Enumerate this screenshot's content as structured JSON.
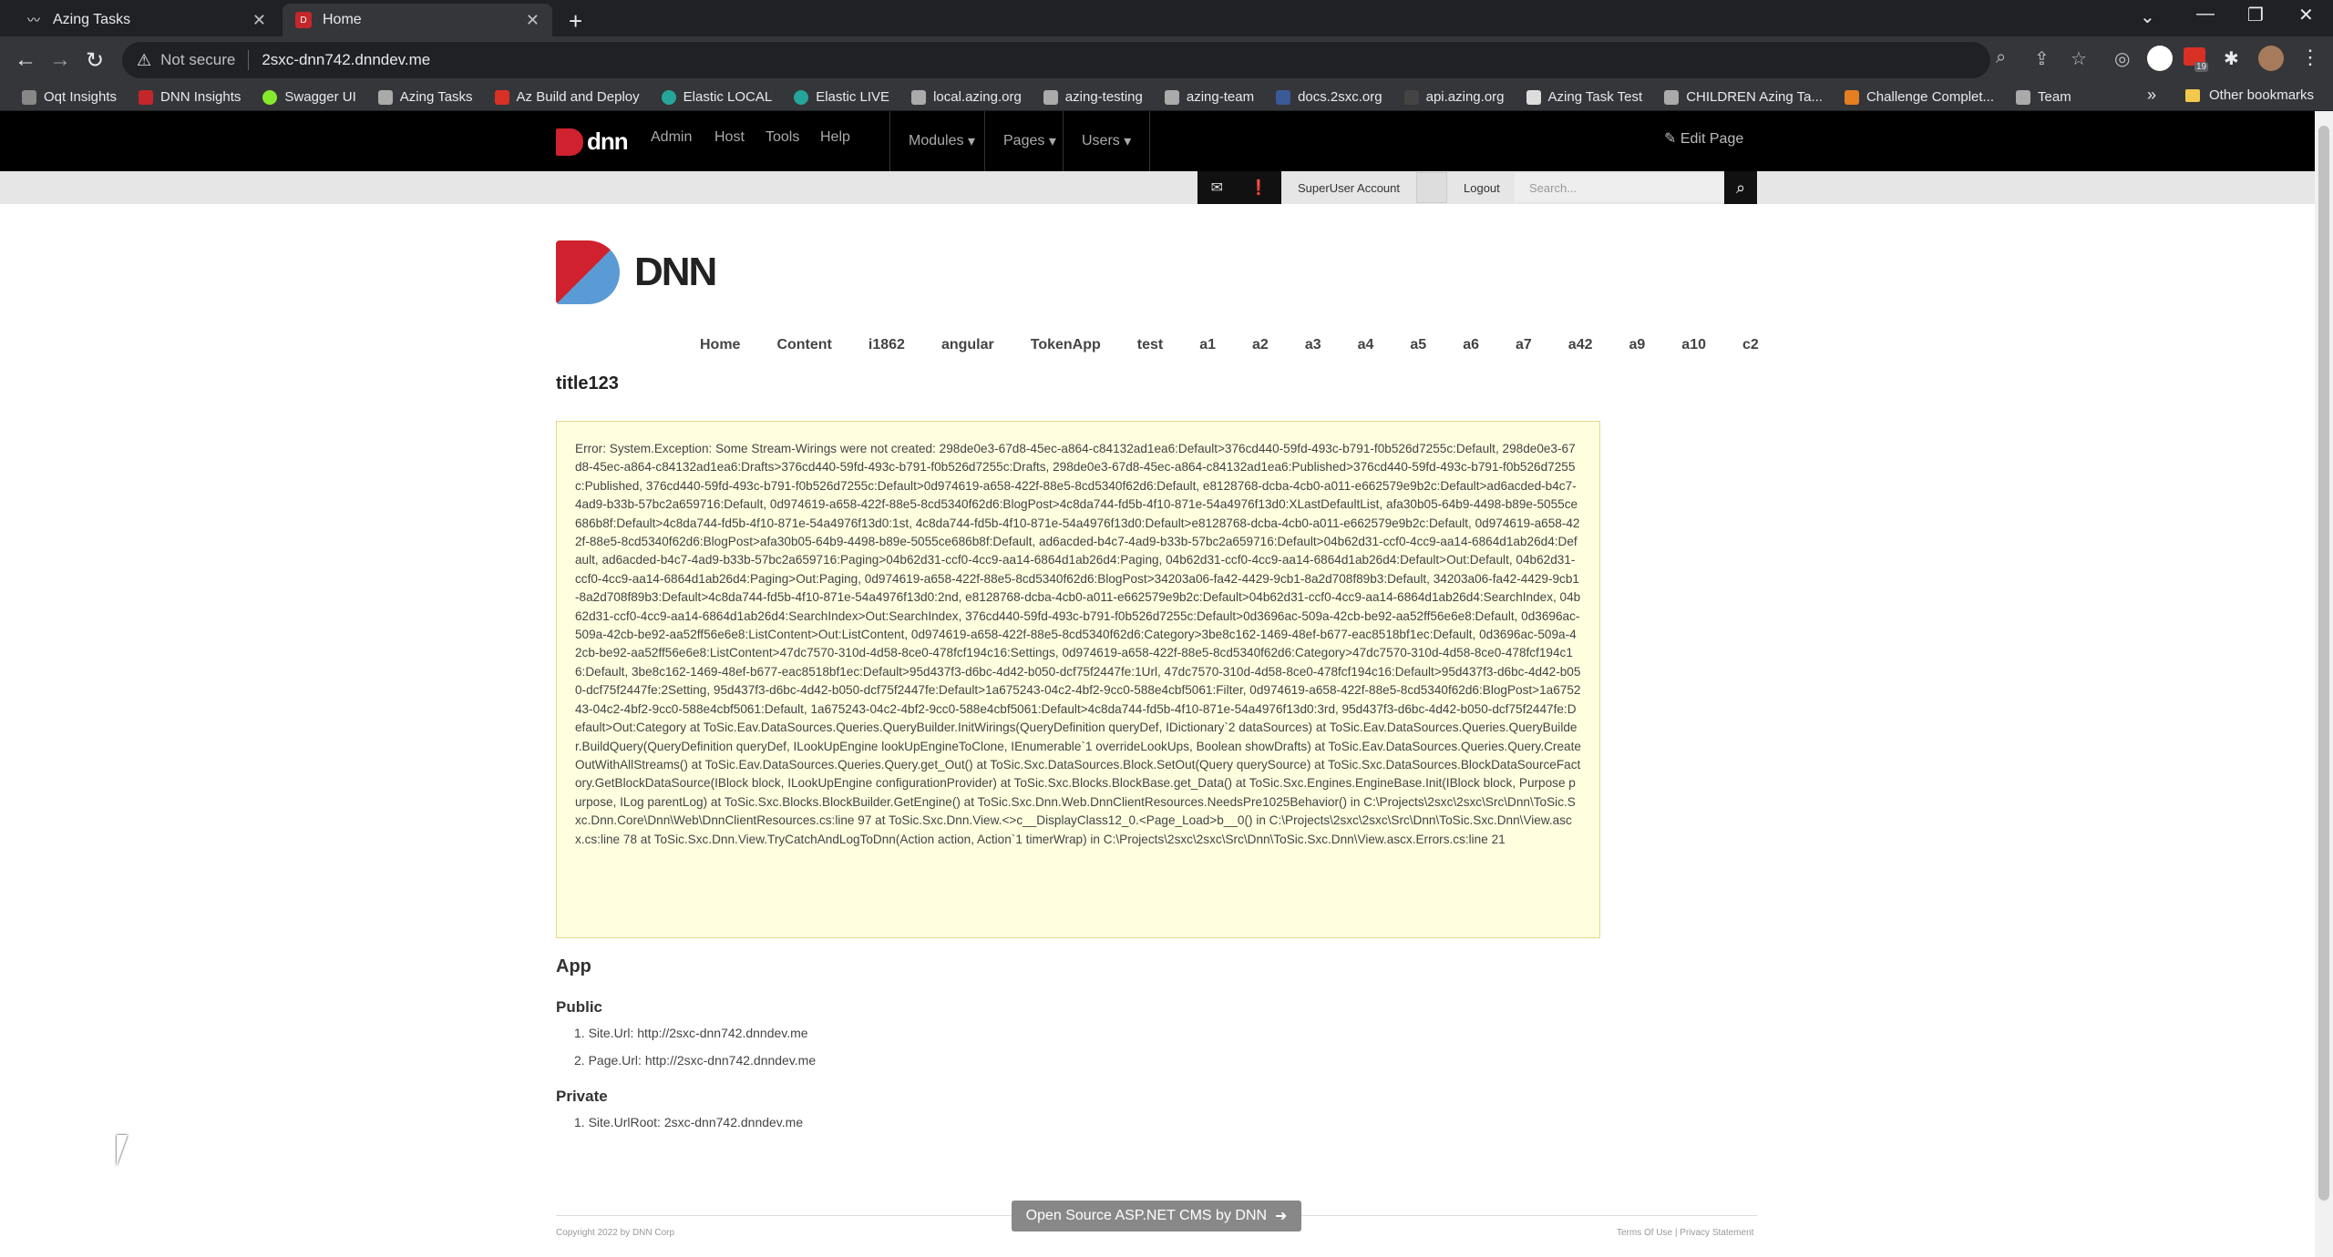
{
  "browser": {
    "tabs": [
      {
        "title": "Azing Tasks",
        "active": false
      },
      {
        "title": "Home",
        "active": true
      }
    ],
    "address": {
      "warning": "Not secure",
      "url": "2sxc-dnn742.dnndev.me"
    },
    "bookmarks": [
      "Oqt Insights",
      "DNN Insights",
      "Swagger UI",
      "Azing Tasks",
      "Az Build and Deploy",
      "Elastic LOCAL",
      "Elastic LIVE",
      "local.azing.org",
      "azing-testing",
      "azing-team",
      "docs.2sxc.org",
      "api.azing.org",
      "Azing Task Test",
      "CHILDREN Azing Ta...",
      "Challenge Complet...",
      "Team"
    ],
    "bookmarks_more": "»",
    "other_bookmarks": "Other bookmarks",
    "extension_badge": "19"
  },
  "persona_bar": {
    "logo": "dnn",
    "menu": [
      "Admin",
      "Host",
      "Tools",
      "Help"
    ],
    "dropdowns": [
      "Modules",
      "Pages",
      "Users"
    ],
    "edit_page": "Edit Page"
  },
  "user_bar": {
    "user_name": "SuperUser Account",
    "logout": "Logout",
    "search_placeholder": "Search..."
  },
  "site": {
    "logo": "DNN",
    "nav": [
      "Home",
      "Content",
      "i1862",
      "angular",
      "TokenApp",
      "test",
      "a1",
      "a2",
      "a3",
      "a4",
      "a5",
      "a6",
      "a7",
      "a42",
      "a9",
      "a10",
      "c2"
    ],
    "page_title": "title123"
  },
  "error": {
    "text": "Error: System.Exception: Some Stream-Wirings were not created: 298de0e3-67d8-45ec-a864-c84132ad1ea6:Default>376cd440-59fd-493c-b791-f0b526d7255c:Default, 298de0e3-67d8-45ec-a864-c84132ad1ea6:Drafts>376cd440-59fd-493c-b791-f0b526d7255c:Drafts, 298de0e3-67d8-45ec-a864-c84132ad1ea6:Published>376cd440-59fd-493c-b791-f0b526d7255c:Published, 376cd440-59fd-493c-b791-f0b526d7255c:Default>0d974619-a658-422f-88e5-8cd5340f62d6:Default, e8128768-dcba-4cb0-a011-e662579e9b2c:Default>ad6acded-b4c7-4ad9-b33b-57bc2a659716:Default, 0d974619-a658-422f-88e5-8cd5340f62d6:BlogPost>4c8da744-fd5b-4f10-871e-54a4976f13d0:XLastDefaultList, afa30b05-64b9-4498-b89e-5055ce686b8f:Default>4c8da744-fd5b-4f10-871e-54a4976f13d0:1st, 4c8da744-fd5b-4f10-871e-54a4976f13d0:Default>e8128768-dcba-4cb0-a011-e662579e9b2c:Default, 0d974619-a658-422f-88e5-8cd5340f62d6:BlogPost>afa30b05-64b9-4498-b89e-5055ce686b8f:Default, ad6acded-b4c7-4ad9-b33b-57bc2a659716:Default>04b62d31-ccf0-4cc9-aa14-6864d1ab26d4:Default, ad6acded-b4c7-4ad9-b33b-57bc2a659716:Paging>04b62d31-ccf0-4cc9-aa14-6864d1ab26d4:Paging, 04b62d31-ccf0-4cc9-aa14-6864d1ab26d4:Default>Out:Default, 04b62d31-ccf0-4cc9-aa14-6864d1ab26d4:Paging>Out:Paging, 0d974619-a658-422f-88e5-8cd5340f62d6:BlogPost>34203a06-fa42-4429-9cb1-8a2d708f89b3:Default, 34203a06-fa42-4429-9cb1-8a2d708f89b3:Default>4c8da744-fd5b-4f10-871e-54a4976f13d0:2nd, e8128768-dcba-4cb0-a011-e662579e9b2c:Default>04b62d31-ccf0-4cc9-aa14-6864d1ab26d4:SearchIndex, 04b62d31-ccf0-4cc9-aa14-6864d1ab26d4:SearchIndex>Out:SearchIndex, 376cd440-59fd-493c-b791-f0b526d7255c:Default>0d3696ac-509a-42cb-be92-aa52ff56e6e8:Default, 0d3696ac-509a-42cb-be92-aa52ff56e6e8:ListContent>Out:ListContent, 0d974619-a658-422f-88e5-8cd5340f62d6:Category>3be8c162-1469-48ef-b677-eac8518bf1ec:Default, 0d3696ac-509a-42cb-be92-aa52ff56e6e8:ListContent>47dc7570-310d-4d58-8ce0-478fcf194c16:Settings, 0d974619-a658-422f-88e5-8cd5340f62d6:Category>47dc7570-310d-4d58-8ce0-478fcf194c16:Default, 3be8c162-1469-48ef-b677-eac8518bf1ec:Default>95d437f3-d6bc-4d42-b050-dcf75f2447fe:1Url, 47dc7570-310d-4d58-8ce0-478fcf194c16:Default>95d437f3-d6bc-4d42-b050-dcf75f2447fe:2Setting, 95d437f3-d6bc-4d42-b050-dcf75f2447fe:Default>1a675243-04c2-4bf2-9cc0-588e4cbf5061:Filter, 0d974619-a658-422f-88e5-8cd5340f62d6:BlogPost>1a675243-04c2-4bf2-9cc0-588e4cbf5061:Default, 1a675243-04c2-4bf2-9cc0-588e4cbf5061:Default>4c8da744-fd5b-4f10-871e-54a4976f13d0:3rd, 95d437f3-d6bc-4d42-b050-dcf75f2447fe:Default>Out:Category at ToSic.Eav.DataSources.Queries.QueryBuilder.InitWirings(QueryDefinition queryDef, IDictionary`2 dataSources) at ToSic.Eav.DataSources.Queries.QueryBuilder.BuildQuery(QueryDefinition queryDef, ILookUpEngine lookUpEngineToClone, IEnumerable`1 overrideLookUps, Boolean showDrafts) at ToSic.Eav.DataSources.Queries.Query.CreateOutWithAllStreams() at ToSic.Eav.DataSources.Queries.Query.get_Out() at ToSic.Sxc.DataSources.Block.SetOut(Query querySource) at ToSic.Sxc.DataSources.BlockDataSourceFactory.GetBlockDataSource(IBlock block, ILookUpEngine configurationProvider) at ToSic.Sxc.Blocks.BlockBase.get_Data() at ToSic.Sxc.Engines.EngineBase.Init(IBlock block, Purpose purpose, ILog parentLog) at ToSic.Sxc.Blocks.BlockBuilder.GetEngine() at ToSic.Sxc.Dnn.Web.DnnClientResources.NeedsPre1025Behavior() in C:\\Projects\\2sxc\\2sxc\\Src\\Dnn\\ToSic.Sxc.Dnn.Core\\Dnn\\Web\\DnnClientResources.cs:line 97 at ToSic.Sxc.Dnn.View.<>c__DisplayClass12_0.<Page_Load>b__0() in C:\\Projects\\2sxc\\2sxc\\Src\\Dnn\\ToSic.Sxc.Dnn\\View.ascx.cs:line 78 at ToSic.Sxc.Dnn.View.TryCatchAndLogToDnn(Action action, Action`1 timerWrap) in C:\\Projects\\2sxc\\2sxc\\Src\\Dnn\\ToSic.Sxc.Dnn\\View.ascx.Errors.cs:line 21"
  },
  "app": {
    "heading": "App",
    "public_heading": "Public",
    "public_items": [
      "Site.Url: http://2sxc-dnn742.dnndev.me",
      "Page.Url: http://2sxc-dnn742.dnndev.me"
    ],
    "private_heading": "Private",
    "private_items": [
      "Site.UrlRoot: 2sxc-dnn742.dnndev.me"
    ]
  },
  "footer": {
    "button": "Open Source ASP.NET CMS by DNN",
    "copyright": "Copyright 2022 by DNN Corp",
    "links": "Terms Of Use | Privacy Statement"
  }
}
